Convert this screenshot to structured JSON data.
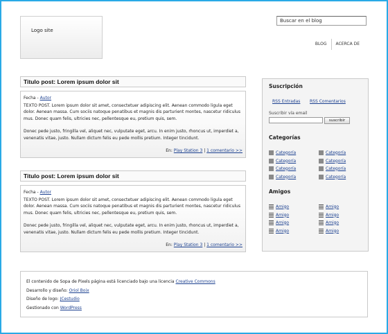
{
  "header": {
    "logo_text": "Logo site",
    "search_value": "Buscar en el blog",
    "nav": [
      "BLOG",
      "ACERCA DE"
    ]
  },
  "posts": [
    {
      "title": "Titulo post: Lorem ipsum dolor sit",
      "date": "Fecha",
      "author": "Autor",
      "paragraphs": [
        "TEXTO POST. Lorem ipsum dolor sit amet, consectetuer adipiscing elit. Aenean commodo ligula eget dolor. Aenean massa. Cum sociis natoque penatibus et magnis dis parturient montes, nascetur ridiculus mus. Donec quam felis, ultricies nec, pellentesque eu, pretium quis, sem.",
        "Donec pede justo, fringilla vel, aliquet nec, vulputate eget, arcu. In enim justo, rhoncus ut, imperdiet a, venenatis vitae, justo. Nullam dictum felis eu pede mollis pretium. Integer tincidunt."
      ],
      "footer_prefix": "En:",
      "category": "Play Station 3",
      "separator": "|",
      "comments": "1 comentario >>"
    },
    {
      "title": "Titulo post: Lorem ipsum dolor sit",
      "date": "Fecha",
      "author": "Autor",
      "paragraphs": [
        "TEXTO POST. Lorem ipsum dolor sit amet, consectetuer adipiscing elit. Aenean commodo ligula eget dolor. Aenean massa. Cum sociis natoque penatibus et magnis dis parturient montes, nascetur ridiculus mus. Donec quam felis, ultricies nec, pellentesque eu, pretium quis, sem.",
        "Donec pede justo, fringilla vel, aliquet nec, vulputate eget, arcu. In enim justo, rhoncus ut, imperdiet a, venenatis vitae, justo. Nullam dictum felis eu pede mollis pretium. Integer tincidunt."
      ],
      "footer_prefix": "En:",
      "category": "Play Station 3",
      "separator": "|",
      "comments": "1 comentario >>"
    }
  ],
  "sidebar": {
    "subscription_title": "Suscripción",
    "rss_entries": "RSS Entradas",
    "rss_comments": "RSS Comentarios",
    "subscribe_label": "Suscribir vía email",
    "subscribe_button": "suscribir",
    "categories_title": "Categorías",
    "categories": [
      "Categoría",
      "Categoría",
      "Categoría",
      "Categoría",
      "Categoría",
      "Categoría",
      "Categoría",
      "Categoría"
    ],
    "friends_title": "Amigos",
    "friends": [
      "Amigo",
      "Amigo",
      "Amigo",
      "Amigo",
      "Amigo",
      "Amigo",
      "Amigo",
      "Amigo"
    ]
  },
  "footer": {
    "license_text": "El contenido de Sopa de Pixels página está licenciado bajo una licencia",
    "license_link": "Creative Commons",
    "dev_text": "Desarrollo y diseño:",
    "dev_link": "Oriol Boix",
    "logo_text": "Diseño de logo:",
    "logo_link": "JCestudio",
    "managed_text": "Gestionado con",
    "managed_link": "WordPress"
  },
  "colors": {
    "frame_border": "#29a9e6",
    "link": "#1a3f8f",
    "panel_border": "#c9c9c9"
  },
  "icons": {
    "category": "square-icon",
    "friend": "list-icon"
  }
}
